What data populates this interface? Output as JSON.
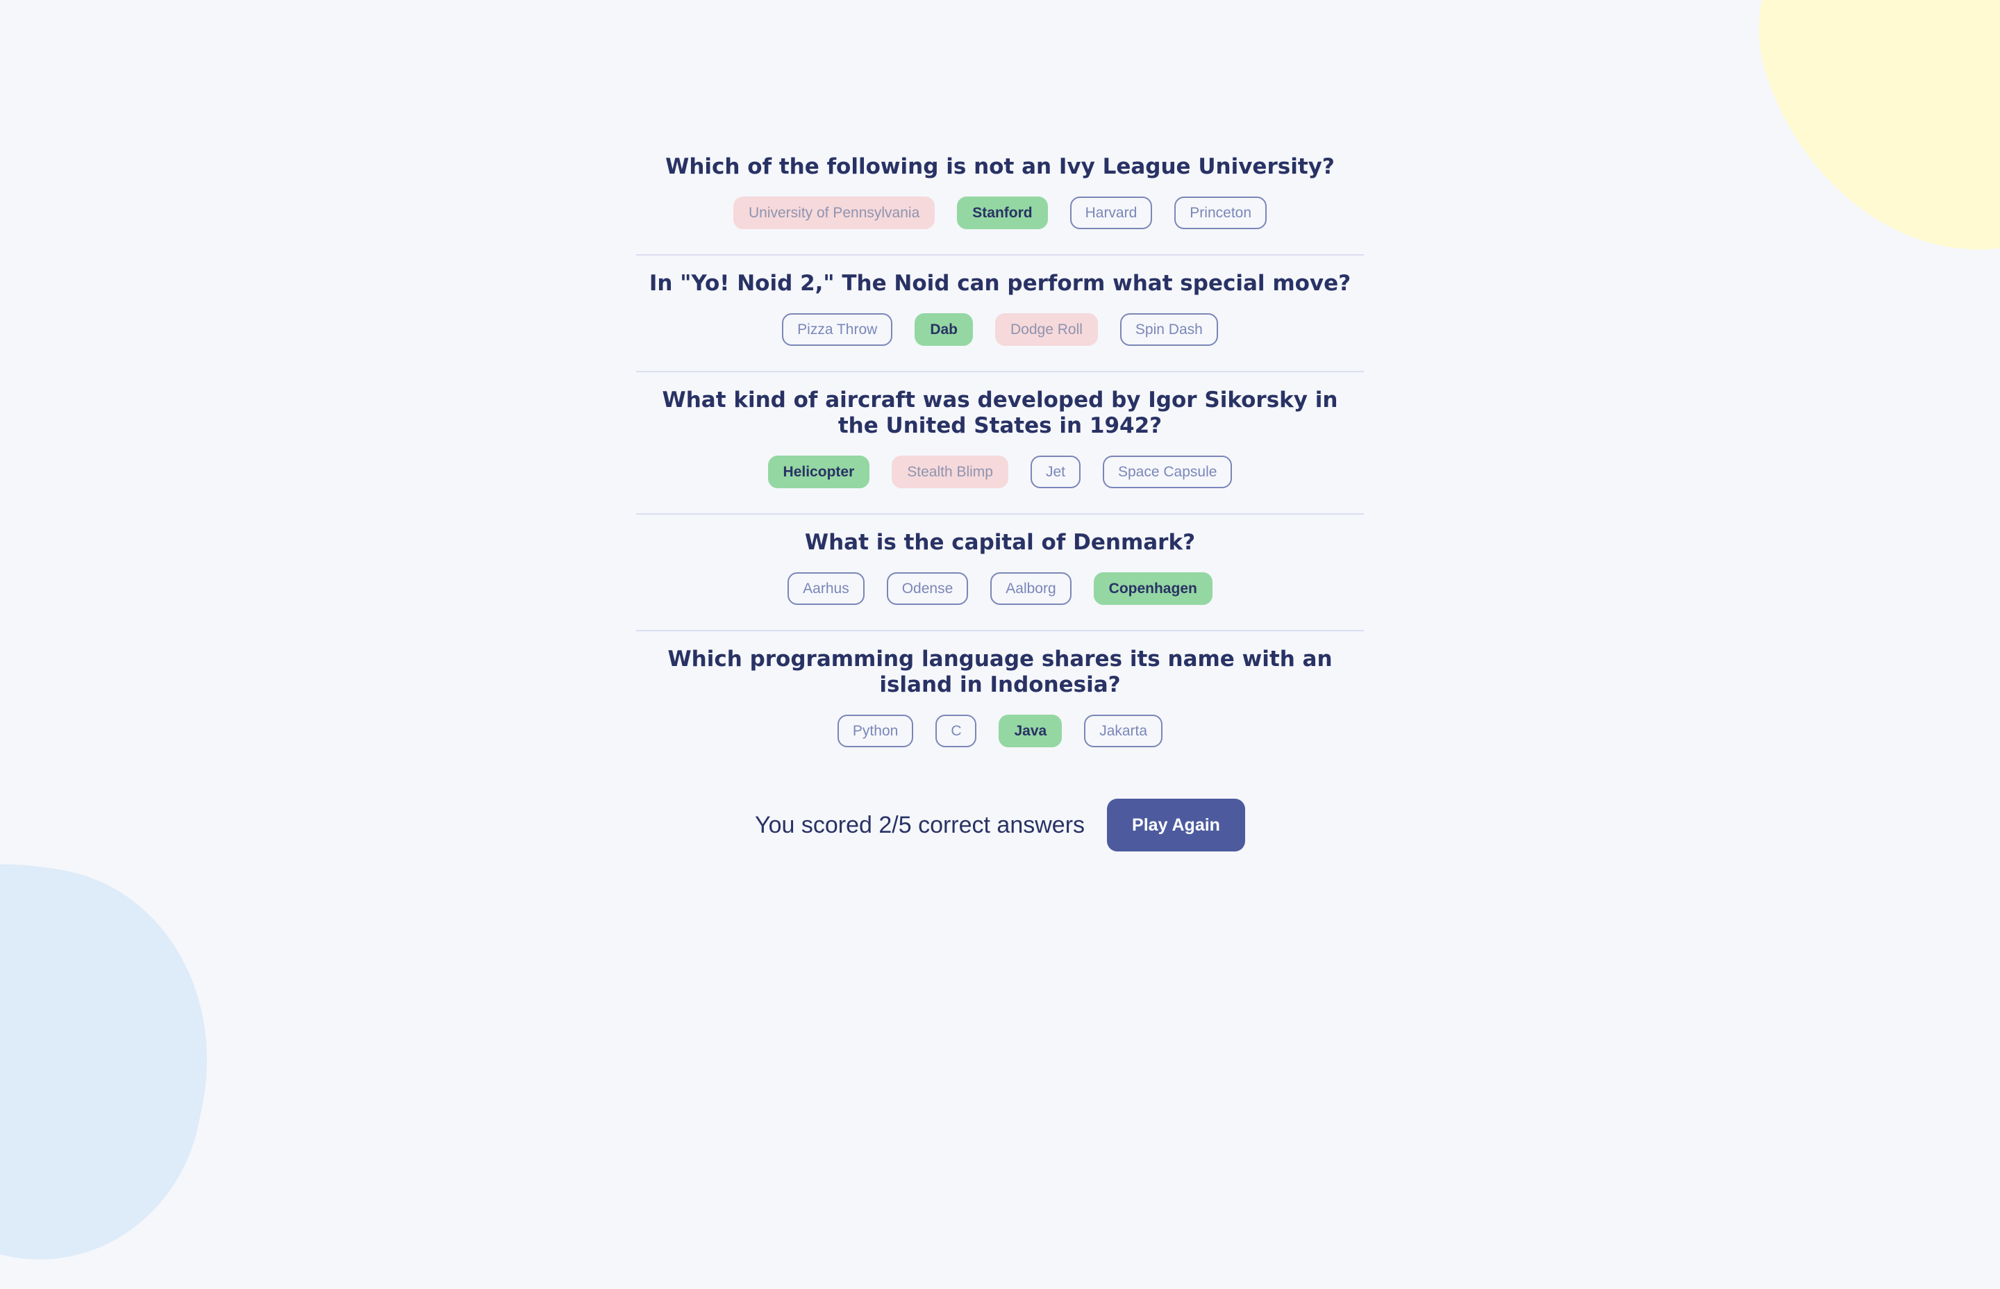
{
  "theme": {
    "background": "#F5F7FB",
    "text": "#293264",
    "accent": "#4D5B9E",
    "correct": "#94D7A2",
    "wrong": "#F8BCBC",
    "blob_yellow": "#FFFAD1",
    "blob_blue": "#DEEBF8"
  },
  "questions": [
    {
      "text": "Which of the following is not an Ivy League University?",
      "answers": [
        {
          "label": "University of Pennsylvania",
          "state": "wrong"
        },
        {
          "label": "Stanford",
          "state": "correct"
        },
        {
          "label": "Harvard",
          "state": "neutral"
        },
        {
          "label": "Princeton",
          "state": "neutral"
        }
      ]
    },
    {
      "text": "In \"Yo! Noid 2,\" The Noid can perform what special move?",
      "answers": [
        {
          "label": "Pizza Throw",
          "state": "neutral"
        },
        {
          "label": "Dab",
          "state": "correct"
        },
        {
          "label": "Dodge Roll",
          "state": "wrong"
        },
        {
          "label": "Spin Dash",
          "state": "neutral"
        }
      ]
    },
    {
      "text": "What kind of aircraft was developed by Igor Sikorsky in the United States in 1942?",
      "answers": [
        {
          "label": "Helicopter",
          "state": "correct"
        },
        {
          "label": "Stealth Blimp",
          "state": "wrong"
        },
        {
          "label": "Jet",
          "state": "neutral"
        },
        {
          "label": "Space Capsule",
          "state": "neutral"
        }
      ]
    },
    {
      "text": "What is the capital of Denmark?",
      "answers": [
        {
          "label": "Aarhus",
          "state": "neutral"
        },
        {
          "label": "Odense",
          "state": "neutral"
        },
        {
          "label": "Aalborg",
          "state": "neutral"
        },
        {
          "label": "Copenhagen",
          "state": "correct"
        }
      ]
    },
    {
      "text": "Which programming language shares its name with an island in Indonesia?",
      "answers": [
        {
          "label": "Python",
          "state": "neutral"
        },
        {
          "label": "C",
          "state": "neutral"
        },
        {
          "label": "Java",
          "state": "correct"
        },
        {
          "label": "Jakarta",
          "state": "neutral"
        }
      ]
    }
  ],
  "footer": {
    "score_text": "You scored 2/5 correct answers",
    "play_again_label": "Play Again"
  }
}
